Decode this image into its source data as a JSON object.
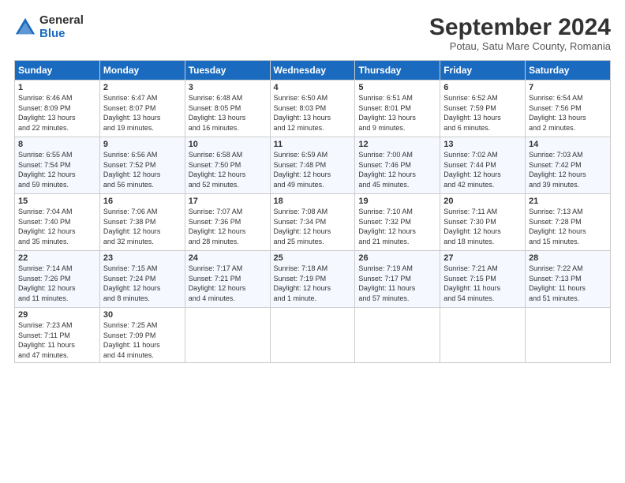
{
  "logo": {
    "general": "General",
    "blue": "Blue"
  },
  "title": "September 2024",
  "subtitle": "Potau, Satu Mare County, Romania",
  "header_days": [
    "Sunday",
    "Monday",
    "Tuesday",
    "Wednesday",
    "Thursday",
    "Friday",
    "Saturday"
  ],
  "weeks": [
    [
      {
        "day": "1",
        "info": "Sunrise: 6:46 AM\nSunset: 8:09 PM\nDaylight: 13 hours\nand 22 minutes."
      },
      {
        "day": "2",
        "info": "Sunrise: 6:47 AM\nSunset: 8:07 PM\nDaylight: 13 hours\nand 19 minutes."
      },
      {
        "day": "3",
        "info": "Sunrise: 6:48 AM\nSunset: 8:05 PM\nDaylight: 13 hours\nand 16 minutes."
      },
      {
        "day": "4",
        "info": "Sunrise: 6:50 AM\nSunset: 8:03 PM\nDaylight: 13 hours\nand 12 minutes."
      },
      {
        "day": "5",
        "info": "Sunrise: 6:51 AM\nSunset: 8:01 PM\nDaylight: 13 hours\nand 9 minutes."
      },
      {
        "day": "6",
        "info": "Sunrise: 6:52 AM\nSunset: 7:59 PM\nDaylight: 13 hours\nand 6 minutes."
      },
      {
        "day": "7",
        "info": "Sunrise: 6:54 AM\nSunset: 7:56 PM\nDaylight: 13 hours\nand 2 minutes."
      }
    ],
    [
      {
        "day": "8",
        "info": "Sunrise: 6:55 AM\nSunset: 7:54 PM\nDaylight: 12 hours\nand 59 minutes."
      },
      {
        "day": "9",
        "info": "Sunrise: 6:56 AM\nSunset: 7:52 PM\nDaylight: 12 hours\nand 56 minutes."
      },
      {
        "day": "10",
        "info": "Sunrise: 6:58 AM\nSunset: 7:50 PM\nDaylight: 12 hours\nand 52 minutes."
      },
      {
        "day": "11",
        "info": "Sunrise: 6:59 AM\nSunset: 7:48 PM\nDaylight: 12 hours\nand 49 minutes."
      },
      {
        "day": "12",
        "info": "Sunrise: 7:00 AM\nSunset: 7:46 PM\nDaylight: 12 hours\nand 45 minutes."
      },
      {
        "day": "13",
        "info": "Sunrise: 7:02 AM\nSunset: 7:44 PM\nDaylight: 12 hours\nand 42 minutes."
      },
      {
        "day": "14",
        "info": "Sunrise: 7:03 AM\nSunset: 7:42 PM\nDaylight: 12 hours\nand 39 minutes."
      }
    ],
    [
      {
        "day": "15",
        "info": "Sunrise: 7:04 AM\nSunset: 7:40 PM\nDaylight: 12 hours\nand 35 minutes."
      },
      {
        "day": "16",
        "info": "Sunrise: 7:06 AM\nSunset: 7:38 PM\nDaylight: 12 hours\nand 32 minutes."
      },
      {
        "day": "17",
        "info": "Sunrise: 7:07 AM\nSunset: 7:36 PM\nDaylight: 12 hours\nand 28 minutes."
      },
      {
        "day": "18",
        "info": "Sunrise: 7:08 AM\nSunset: 7:34 PM\nDaylight: 12 hours\nand 25 minutes."
      },
      {
        "day": "19",
        "info": "Sunrise: 7:10 AM\nSunset: 7:32 PM\nDaylight: 12 hours\nand 21 minutes."
      },
      {
        "day": "20",
        "info": "Sunrise: 7:11 AM\nSunset: 7:30 PM\nDaylight: 12 hours\nand 18 minutes."
      },
      {
        "day": "21",
        "info": "Sunrise: 7:13 AM\nSunset: 7:28 PM\nDaylight: 12 hours\nand 15 minutes."
      }
    ],
    [
      {
        "day": "22",
        "info": "Sunrise: 7:14 AM\nSunset: 7:26 PM\nDaylight: 12 hours\nand 11 minutes."
      },
      {
        "day": "23",
        "info": "Sunrise: 7:15 AM\nSunset: 7:24 PM\nDaylight: 12 hours\nand 8 minutes."
      },
      {
        "day": "24",
        "info": "Sunrise: 7:17 AM\nSunset: 7:21 PM\nDaylight: 12 hours\nand 4 minutes."
      },
      {
        "day": "25",
        "info": "Sunrise: 7:18 AM\nSunset: 7:19 PM\nDaylight: 12 hours\nand 1 minute."
      },
      {
        "day": "26",
        "info": "Sunrise: 7:19 AM\nSunset: 7:17 PM\nDaylight: 11 hours\nand 57 minutes."
      },
      {
        "day": "27",
        "info": "Sunrise: 7:21 AM\nSunset: 7:15 PM\nDaylight: 11 hours\nand 54 minutes."
      },
      {
        "day": "28",
        "info": "Sunrise: 7:22 AM\nSunset: 7:13 PM\nDaylight: 11 hours\nand 51 minutes."
      }
    ],
    [
      {
        "day": "29",
        "info": "Sunrise: 7:23 AM\nSunset: 7:11 PM\nDaylight: 11 hours\nand 47 minutes."
      },
      {
        "day": "30",
        "info": "Sunrise: 7:25 AM\nSunset: 7:09 PM\nDaylight: 11 hours\nand 44 minutes."
      },
      {
        "day": "",
        "info": ""
      },
      {
        "day": "",
        "info": ""
      },
      {
        "day": "",
        "info": ""
      },
      {
        "day": "",
        "info": ""
      },
      {
        "day": "",
        "info": ""
      }
    ]
  ]
}
